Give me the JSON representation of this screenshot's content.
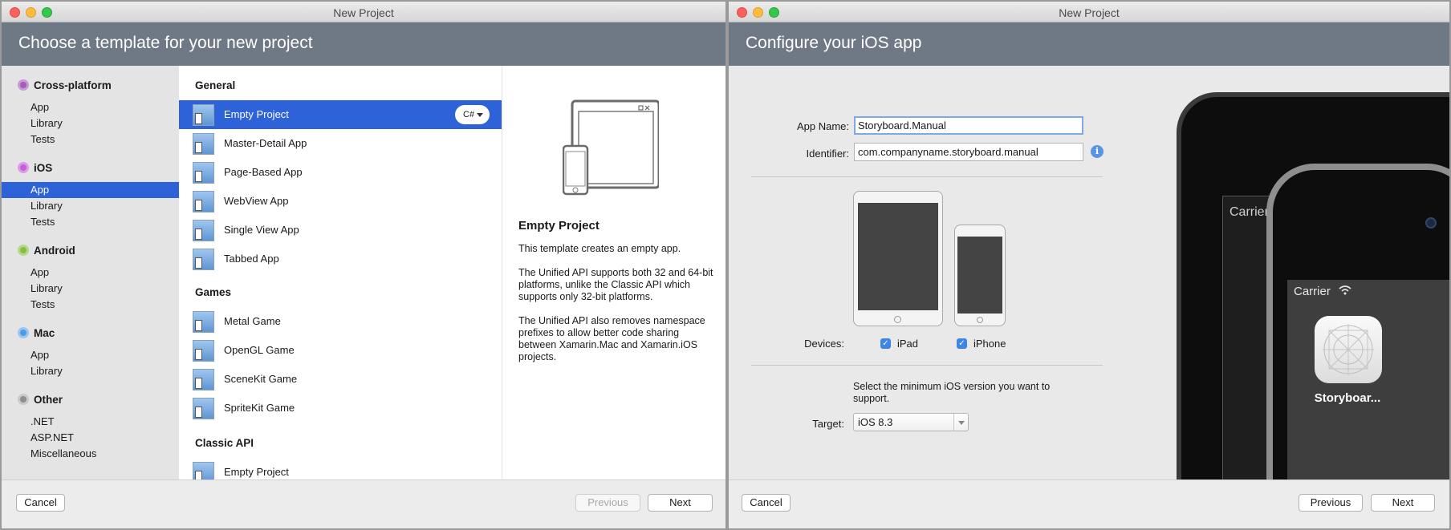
{
  "left_window": {
    "title": "New Project",
    "header": "Choose a template for your new project",
    "categories": [
      {
        "label": "Cross-platform",
        "icon": "cross-platform-icon",
        "items": [
          "App",
          "Library",
          "Tests"
        ]
      },
      {
        "label": "iOS",
        "icon": "ios-icon",
        "items": [
          "App",
          "Library",
          "Tests"
        ],
        "selected_item": "App"
      },
      {
        "label": "Android",
        "icon": "android-icon",
        "items": [
          "App",
          "Library",
          "Tests"
        ]
      },
      {
        "label": "Mac",
        "icon": "mac-icon",
        "items": [
          "App",
          "Library"
        ]
      },
      {
        "label": "Other",
        "icon": "other-icon",
        "items": [
          ".NET",
          "ASP.NET",
          "Miscellaneous"
        ]
      }
    ],
    "sections": [
      {
        "label": "General",
        "items": [
          "Empty Project",
          "Master-Detail App",
          "Page-Based App",
          "WebView App",
          "Single View App",
          "Tabbed App"
        ]
      },
      {
        "label": "Games",
        "items": [
          "Metal Game",
          "OpenGL Game",
          "SceneKit Game",
          "SpriteKit Game"
        ]
      },
      {
        "label": "Classic API",
        "items": [
          "Empty Project"
        ]
      }
    ],
    "selected_template": "Empty Project",
    "language_badge": "C#",
    "detail": {
      "title": "Empty Project",
      "paragraphs": [
        "This template creates an empty app.",
        "The Unified API supports both 32 and 64-bit platforms, unlike the Classic API which supports only 32-bit platforms.",
        "The Unified API also removes namespace prefixes to allow better code sharing between Xamarin.Mac and Xamarin.iOS projects."
      ]
    },
    "footer": {
      "cancel": "Cancel",
      "previous": "Previous",
      "next": "Next"
    }
  },
  "right_window": {
    "title": "New Project",
    "header": "Configure your iOS app",
    "form": {
      "app_name_label": "App Name:",
      "app_name_value": "Storyboard.Manual",
      "identifier_label": "Identifier:",
      "identifier_value": "com.companyname.storyboard.manual",
      "devices_label": "Devices:",
      "ipad_label": "iPad",
      "ipad_checked": true,
      "iphone_label": "iPhone",
      "iphone_checked": true,
      "target_hint": "Select the minimum iOS version you want to support.",
      "target_label": "Target:",
      "target_value": "iOS 8.3"
    },
    "preview": {
      "carrier_ipad": "Carrier",
      "carrier_iphone": "Carrier",
      "app_name": "Storyboar..."
    },
    "footer": {
      "cancel": "Cancel",
      "previous": "Previous",
      "next": "Next"
    }
  },
  "colors": {
    "banner": "#6f7985",
    "selection": "#2e62d9",
    "checkbox": "#3d86e8"
  }
}
